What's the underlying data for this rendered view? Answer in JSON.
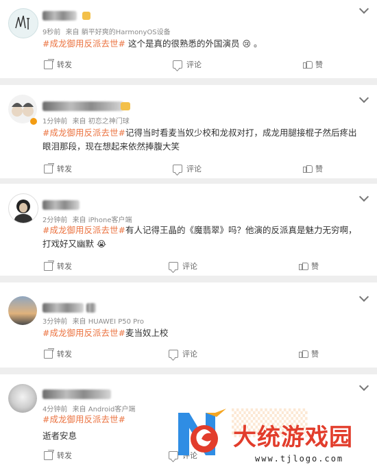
{
  "posts": [
    {
      "time": "9秒前",
      "source": "来自 躺平好爽的HarmonyOS设备",
      "hashtag": "#成龙御用反派去世#",
      "text": "这个是真的很熟悉的外国演员",
      "emoji": "😢",
      "suffix": "。",
      "share": "转发",
      "comment": "评论",
      "like": "赞"
    },
    {
      "time": "1分钟前",
      "source": "来自 初恋之神门球",
      "hashtag": "#成龙御用反派去世#",
      "text": "记得当时看麦当奴少校和龙叔对打，成龙用腿接棍子然后疼出眼泪那段，现在想起来依然捧腹大笑",
      "share": "转发",
      "comment": "评论",
      "like": "赞"
    },
    {
      "time": "2分钟前",
      "source": "来自 iPhone客户端",
      "hashtag": "#成龙御用反派去世#",
      "text": "有人记得王晶的《魔翡翠》吗？他演的反派真是魅力无穷啊，打戏好又幽默",
      "emoji": "😭",
      "share": "转发",
      "comment": "评论",
      "like": "赞"
    },
    {
      "time": "3分钟前",
      "source": "来自 HUAWEI P50 Pro",
      "hashtag": "#成龙御用反派去世#",
      "text": "麦当奴上校",
      "share": "转发",
      "comment": "评论",
      "like": "赞"
    },
    {
      "time": "4分钟前",
      "source": "来自 Android客户端",
      "hashtag": "#成龙御用反派去世#",
      "text": "逝者安息",
      "share": "转发",
      "comment": "评论",
      "like": "赞"
    }
  ],
  "watermark": {
    "title": "大统游戏园",
    "url": "www.tjlogo.com"
  },
  "colors": {
    "hashtag": "#eb7340",
    "background": "#eeeeee",
    "card": "#ffffff"
  }
}
